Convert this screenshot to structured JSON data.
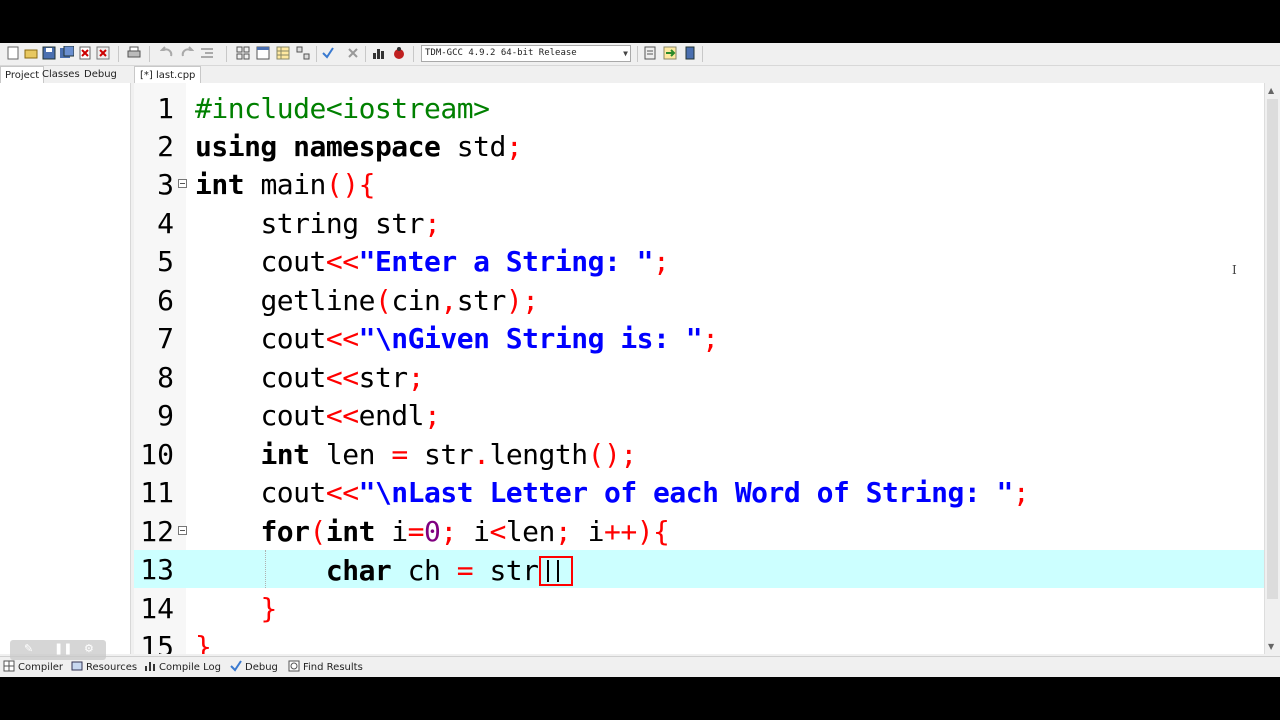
{
  "compiler": {
    "selected": "TDM-GCC 4.9.2 64-bit Release"
  },
  "left_tabs": [
    "Project",
    "Classes",
    "Debug"
  ],
  "editor_tab": "[*] last.cpp",
  "bottom_tabs": [
    "Compiler",
    "Resources",
    "Compile Log",
    "Debug",
    "Find Results"
  ],
  "code_lines": [
    {
      "n": "1"
    },
    {
      "n": "2"
    },
    {
      "n": "3"
    },
    {
      "n": "4"
    },
    {
      "n": "5"
    },
    {
      "n": "6"
    },
    {
      "n": "7"
    },
    {
      "n": "8"
    },
    {
      "n": "9"
    },
    {
      "n": "10"
    },
    {
      "n": "11"
    },
    {
      "n": "12"
    },
    {
      "n": "13"
    },
    {
      "n": "14"
    },
    {
      "n": "15"
    }
  ],
  "code": {
    "l1": {
      "pp": "#include<iostream>"
    },
    "l2": {
      "kw1": "using",
      "kw2": "namespace",
      "id": "std",
      "semi": ";"
    },
    "l3": {
      "kw": "int",
      "id": "main",
      "sym": "(){"
    },
    "l4": {
      "id": "string str",
      "semi": ";"
    },
    "l5": {
      "id": "cout",
      "op": "<<",
      "str": "\"Enter a String: \"",
      "semi": ";"
    },
    "l6": {
      "id1": "getline",
      "p1": "(",
      "id2": "cin",
      "c": ",",
      "id3": "str",
      "p2": ");"
    },
    "l7": {
      "id": "cout",
      "op": "<<",
      "str": "\"\\nGiven String is: \"",
      "semi": ";"
    },
    "l8": {
      "id": "cout",
      "op": "<<",
      "id2": "str",
      "semi": ";"
    },
    "l9": {
      "id": "cout",
      "op": "<<",
      "id2": "endl",
      "semi": ";"
    },
    "l10": {
      "kw": "int",
      "id": " len ",
      "op": "=",
      "id2": " str",
      "dot": ".",
      "id3": "length",
      "p": "();"
    },
    "l11": {
      "id": "cout",
      "op": "<<",
      "str": "\"\\nLast Letter of each Word of String: \"",
      "semi": ";"
    },
    "l12": {
      "kw": "for",
      "p1": "(",
      "kw2": "int",
      "id": " i",
      "eq": "=",
      "num": "0",
      "s1": ";",
      "id2": " i",
      "lt": "<",
      "id3": "len",
      "s2": ";",
      "id4": " i",
      "inc": "++",
      "p2": "){"
    },
    "l13": {
      "kw": "char",
      "id": " ch ",
      "op": "=",
      "id2": " str"
    },
    "l14": {
      "sym": "}"
    },
    "l15": {
      "sym": "}"
    }
  },
  "colors": {
    "current_line": "#ccffff",
    "symbol": "#ff0000",
    "string": "#0000ff",
    "preprocessor": "#008000",
    "number": "#800080"
  }
}
